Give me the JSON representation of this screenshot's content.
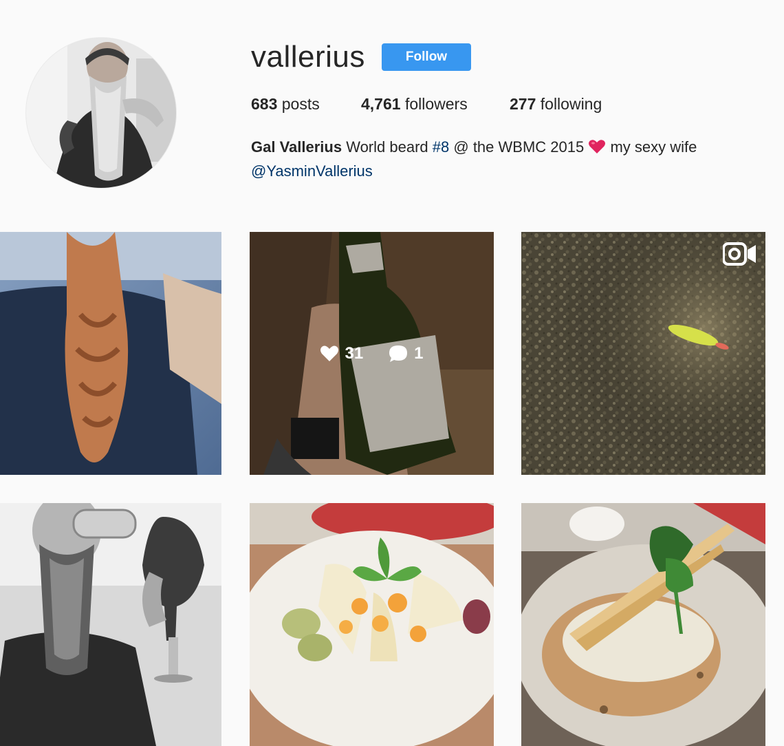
{
  "profile": {
    "username": "vallerius",
    "follow_label": "Follow",
    "avatar_icon": "avatar-photo"
  },
  "stats": {
    "posts_count": "683",
    "posts_label": "posts",
    "followers_count": "4,761",
    "followers_label": "followers",
    "following_count": "277",
    "following_label": "following"
  },
  "bio": {
    "name": "Gal Vallerius",
    "text1": "World beard",
    "hashtag": "#8",
    "text2": "@ the WBMC 2015",
    "emoji": "red-heart-icon",
    "text3": "my sexy wife",
    "mention": "@YasminVallerius"
  },
  "posts": [
    {
      "id": "braid-beard"
    },
    {
      "id": "wine-bottle",
      "likes": "31",
      "comments": "1"
    },
    {
      "id": "caterpillar-video",
      "icon": "video-icon"
    },
    {
      "id": "beard-wine-glass"
    },
    {
      "id": "fruit-salad"
    },
    {
      "id": "chicken-dish"
    }
  ],
  "colors": {
    "accent": "#3897f0",
    "link": "#003569",
    "background": "#fafafa",
    "text": "#262626"
  }
}
